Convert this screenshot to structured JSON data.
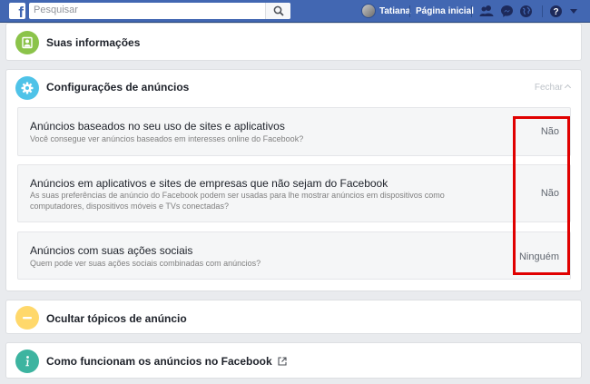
{
  "topbar": {
    "search_placeholder": "Pesquisar",
    "user_name": "Tatiana",
    "home_label": "Página inicial",
    "icons": [
      "facebook-logo-icon",
      "search-icon",
      "friend-requests-icon",
      "messenger-icon",
      "notifications-globe-icon",
      "help-icon",
      "dropdown-caret-icon"
    ]
  },
  "sections": {
    "your_info": {
      "title": "Suas informações"
    },
    "ad_settings": {
      "title": "Configurações de anúncios",
      "close_label": "Fechar",
      "settings": [
        {
          "title": "Anúncios baseados no seu uso de sites e aplicativos",
          "description": "Você consegue ver anúncios baseados em interesses online do Facebook?",
          "value": "Não"
        },
        {
          "title": "Anúncios em aplicativos e sites de empresas que não sejam do Facebook",
          "description": "As suas preferências de anúncio do Facebook podem ser usadas para lhe mostrar anúncios em dispositivos como computadores, dispositivos móveis e TVs conectadas?",
          "value": "Não"
        },
        {
          "title": "Anúncios com suas ações sociais",
          "description": "Quem pode ver suas ações sociais combinadas com anúncios?",
          "value": "Ninguém"
        }
      ]
    },
    "hide_topics": {
      "title": "Ocultar tópicos de anúncio"
    },
    "how_ads_work": {
      "title": "Como funcionam os anúncios no Facebook"
    }
  },
  "colors": {
    "topbar": "#4267b2",
    "your_info_icon": "#8bc34a",
    "ad_settings_icon": "#4fc3e8",
    "hide_topics_icon": "#ffd86b",
    "how_ads_work_icon": "#3db4a0",
    "highlight_box": "#e00000"
  }
}
